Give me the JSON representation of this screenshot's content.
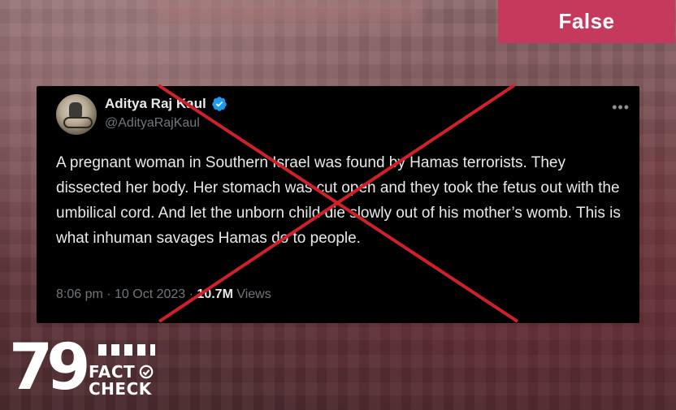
{
  "verdict": {
    "label": "False",
    "color": "#c4395c"
  },
  "tweet": {
    "author_name": "Aditya Raj Kaul",
    "author_handle": "@AdityaRajKaul",
    "verified_icon": "verified-badge-icon",
    "more_icon": "more-options-icon",
    "more_glyph": "•••",
    "text": "A pregnant woman in Southern Israel was found by Hamas terrorists. They dissected her body. Her stomach was cut open and they took the fetus out with the umbilical cord. And let the unborn child die slowly out of his mother’s womb. This is what inhuman savages Hamas do to people.",
    "time": "8:06 pm",
    "separator": " · ",
    "date": "10 Oct 2023",
    "views_count": "10.7M",
    "views_label": "Views"
  },
  "overlay": {
    "cross_color": "#d0202a",
    "meaning": "red-cross-icon"
  },
  "logo": {
    "number": "79",
    "line1": "FACT",
    "line2": "CHECK"
  }
}
